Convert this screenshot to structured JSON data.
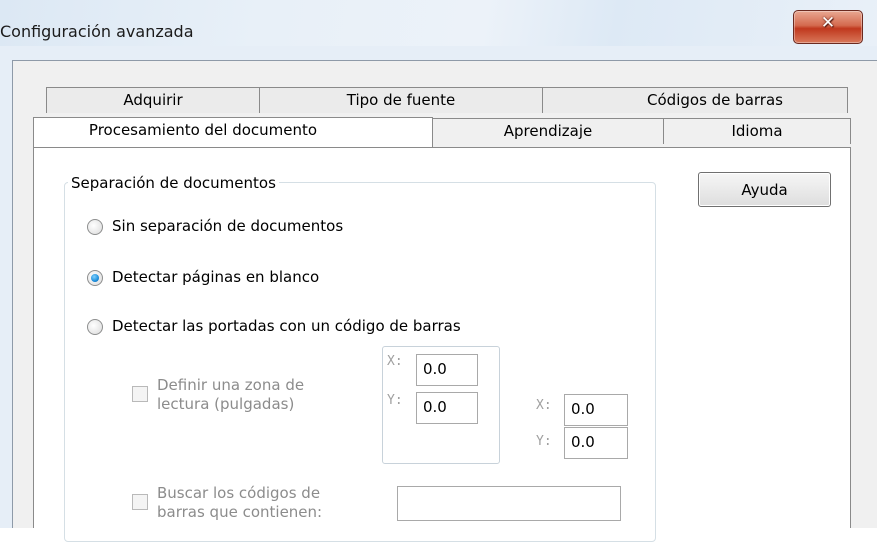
{
  "window": {
    "title": "Configuración avanzada",
    "close_glyph": "✕"
  },
  "tabs": {
    "back_row": [
      "Adquirir",
      "Tipo de fuente",
      "Códigos de barras"
    ],
    "front_row": [
      "Procesamiento del documento",
      "Aprendizaje",
      "Idioma"
    ],
    "active": "Procesamiento del documento"
  },
  "help_button": "Ayuda",
  "document_separation": {
    "group_title": "Separación de documentos",
    "options": [
      {
        "label": "Sin separación de documentos",
        "checked": false
      },
      {
        "label": "Detectar páginas en blanco",
        "checked": true
      },
      {
        "label": "Detectar las portadas con un código de barras",
        "checked": false
      }
    ],
    "read_zone": {
      "label_line1": "Definir una zona de",
      "label_line2": "lectura (pulgadas)",
      "checked": false,
      "x_label": "X:",
      "y_label": "Y:",
      "x1": "0.0",
      "y1": "0.0",
      "x2": "0.0",
      "y2": "0.0"
    },
    "barcode_search": {
      "label_line1": "Buscar los códigos de",
      "label_line2": "barras que contienen:",
      "checked": false,
      "value": ""
    }
  },
  "colors": {
    "accent_radio": "#1e8fdb",
    "close_button": "#c0381e",
    "disabled_text": "#8c8c8c"
  }
}
